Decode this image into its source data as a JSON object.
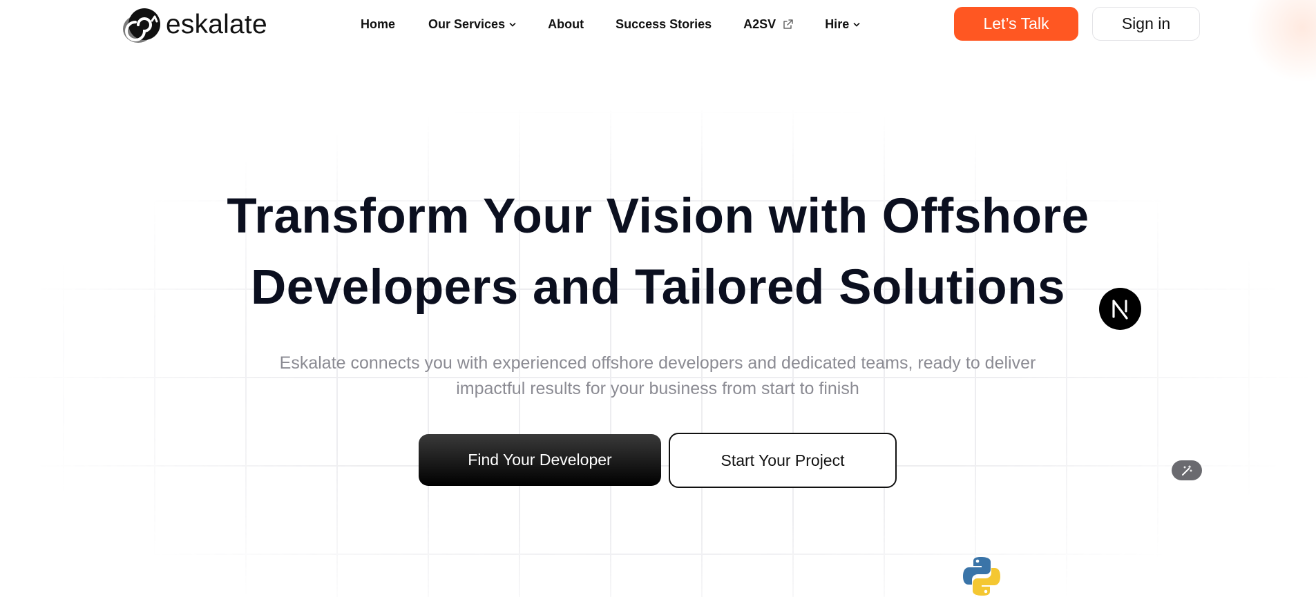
{
  "brand": {
    "name": "eskalate",
    "accent": "#ff5722"
  },
  "nav": {
    "items": [
      {
        "label": "Home",
        "has_dropdown": false,
        "external": false
      },
      {
        "label": "Our Services",
        "has_dropdown": true,
        "external": false
      },
      {
        "label": "About",
        "has_dropdown": false,
        "external": false
      },
      {
        "label": "Success Stories",
        "has_dropdown": false,
        "external": false
      },
      {
        "label": "A2SV",
        "has_dropdown": false,
        "external": true
      },
      {
        "label": "Hire",
        "has_dropdown": true,
        "external": false
      }
    ],
    "cta_label": "Let’s Talk",
    "signin_label": "Sign in"
  },
  "hero": {
    "title_line1": "Transform Your Vision with Offshore",
    "title_line2": "Developers and Tailored Solutions",
    "subtitle_line1": "Eskalate connects you with experienced offshore developers and dedicated teams, ready to deliver",
    "subtitle_line2": "impactful results for your business from start to finish",
    "primary_cta": "Find Your Developer",
    "secondary_cta": "Start Your Project"
  },
  "floating": {
    "nextjs_icon": "nextjs-logo-icon",
    "python_icon": "python-logo-icon",
    "magic_icon": "magic-wand-icon"
  }
}
